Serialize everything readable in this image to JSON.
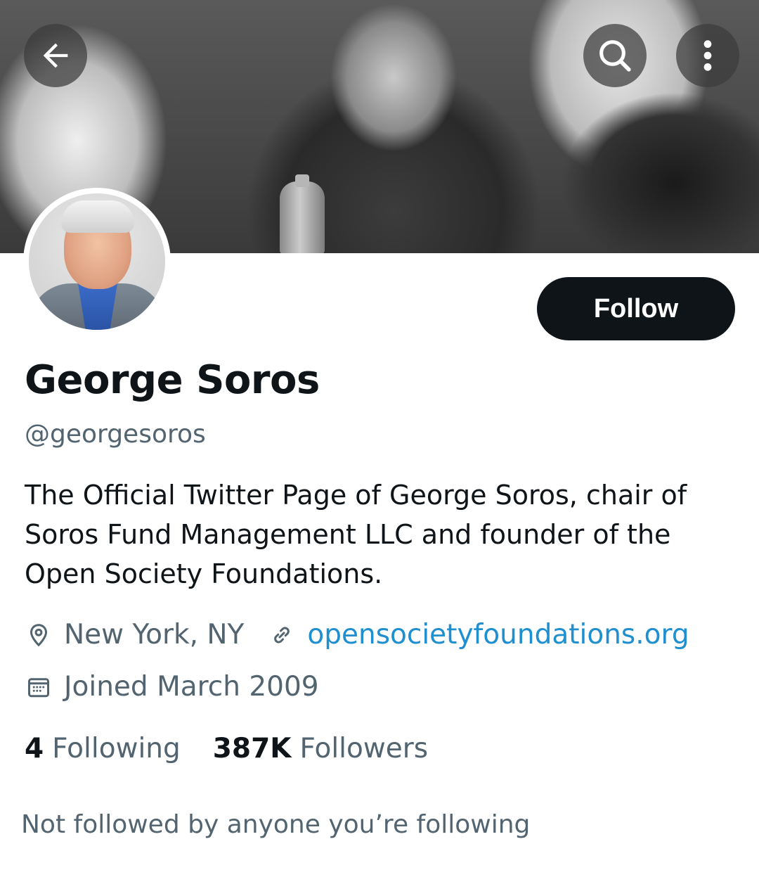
{
  "header": {
    "back_icon": "arrow-left-icon",
    "search_icon": "search-icon",
    "more_icon": "more-vertical-icon"
  },
  "profile": {
    "name": "George Soros",
    "handle": "@georgesoros",
    "follow_label": "Follow",
    "bio": "The Official Twitter Page of George Soros, chair of Soros Fund Management LLC and founder of the Open Society Foundations.",
    "location": "New York, NY",
    "website": "opensocietyfoundations.org",
    "joined": "Joined March 2009",
    "following_count": "4",
    "following_label": "Following",
    "followers_count": "387K",
    "followers_label": "Followers",
    "mutuals_note": "Not followed by anyone you’re following"
  },
  "colors": {
    "primary_text": "#0f1419",
    "secondary_text": "#536471",
    "link": "#1f8fcf",
    "button_bg": "#0f1419"
  }
}
